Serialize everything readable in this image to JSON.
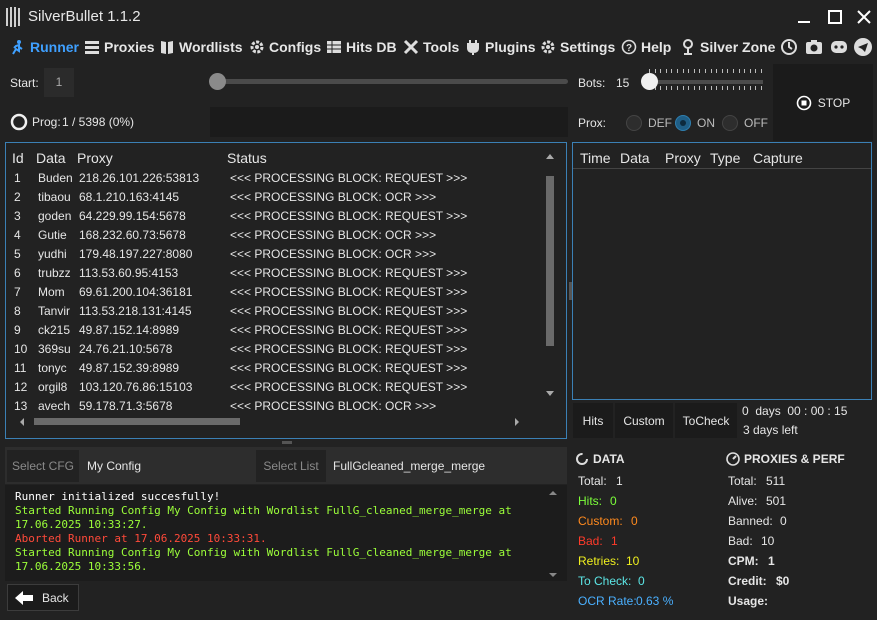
{
  "window": {
    "title": "SilverBullet 1.1.2"
  },
  "nav": [
    {
      "label": "Runner",
      "icon": "runner-icon"
    },
    {
      "label": "Proxies",
      "icon": "proxies-icon"
    },
    {
      "label": "Wordlists",
      "icon": "wordlists-icon"
    },
    {
      "label": "Configs",
      "icon": "configs-icon"
    },
    {
      "label": "Hits DB",
      "icon": "hitsdb-icon"
    },
    {
      "label": "Tools",
      "icon": "tools-icon"
    },
    {
      "label": "Plugins",
      "icon": "plugins-icon"
    },
    {
      "label": "Settings",
      "icon": "settings-icon"
    },
    {
      "label": "Help",
      "icon": "help-icon"
    },
    {
      "label": "Silver Zone",
      "icon": "pin-icon"
    }
  ],
  "controls": {
    "start_label": "Start:",
    "start_value": "1",
    "bots_label": "Bots:",
    "bots_value": "15",
    "stop_label": "STOP",
    "prog_label": "Prog:",
    "prog_value": "1 / 5398 (0%)",
    "prox_label": "Prox:",
    "prox_options": [
      "DEF",
      "ON",
      "OFF"
    ],
    "prox_selected": "ON"
  },
  "grid": {
    "columns": [
      "Id",
      "Data",
      "Proxy",
      "Status"
    ],
    "rows": [
      {
        "id": "1",
        "data": "Buden",
        "proxy": "218.26.101.226:53813",
        "status": "<<< PROCESSING BLOCK: REQUEST >>>"
      },
      {
        "id": "2",
        "data": "tibaou",
        "proxy": "68.1.210.163:4145",
        "status": "<<< PROCESSING BLOCK: OCR >>>"
      },
      {
        "id": "3",
        "data": "goden",
        "proxy": "64.229.99.154:5678",
        "status": "<<< PROCESSING BLOCK: REQUEST >>>"
      },
      {
        "id": "4",
        "data": "Gutie",
        "proxy": "168.232.60.73:5678",
        "status": "<<< PROCESSING BLOCK: OCR >>>"
      },
      {
        "id": "5",
        "data": "yudhi",
        "proxy": "179.48.197.227:8080",
        "status": "<<< PROCESSING BLOCK: OCR >>>"
      },
      {
        "id": "6",
        "data": "trubzz",
        "proxy": "113.53.60.95:4153",
        "status": "<<< PROCESSING BLOCK: REQUEST >>>"
      },
      {
        "id": "7",
        "data": "Mom",
        "proxy": "69.61.200.104:36181",
        "status": "<<< PROCESSING BLOCK: REQUEST >>>"
      },
      {
        "id": "8",
        "data": "Tanvir",
        "proxy": "113.53.218.131:4145",
        "status": "<<< PROCESSING BLOCK: REQUEST >>>"
      },
      {
        "id": "9",
        "data": "ck215",
        "proxy": "49.87.152.14:8989",
        "status": "<<< PROCESSING BLOCK: REQUEST >>>"
      },
      {
        "id": "10",
        "data": "369su",
        "proxy": "24.76.21.10:5678",
        "status": "<<< PROCESSING BLOCK: REQUEST >>>"
      },
      {
        "id": "11",
        "data": "tonyc",
        "proxy": "49.87.152.39:8989",
        "status": "<<< PROCESSING BLOCK: REQUEST >>>"
      },
      {
        "id": "12",
        "data": "orgil8",
        "proxy": "103.120.76.86:15103",
        "status": "<<< PROCESSING BLOCK: REQUEST >>>"
      },
      {
        "id": "13",
        "data": "avech",
        "proxy": "59.178.71.3:5678",
        "status": "<<< PROCESSING BLOCK: OCR >>>"
      }
    ]
  },
  "hits": {
    "columns": [
      "Time",
      "Data",
      "Proxy",
      "Type",
      "Capture"
    ],
    "tabs": [
      "Hits",
      "Custom",
      "ToCheck"
    ],
    "timer": "0  days  00 : 00 : 15",
    "days_left": "3 days left"
  },
  "cfg": {
    "select_cfg_label": "Select CFG",
    "cfg_value": "My Config",
    "select_list_label": "Select List",
    "list_value": "FullGcleaned_merge_merge"
  },
  "log": [
    {
      "text": "Runner initialized succesfully!",
      "color": "#ffffff"
    },
    {
      "text": "Started Running Config My Config with Wordlist FullG_cleaned_merge_merge at 17.06.2025 10:33:27.",
      "color": "#9cff3a"
    },
    {
      "text": "Aborted Runner at 17.06.2025 10:33:31.",
      "color": "#ff4a3a"
    },
    {
      "text": "Started Running Config My Config with Wordlist FullG_cleaned_merge_merge at 17.06.2025 10:33:56.",
      "color": "#9cff3a"
    }
  ],
  "back_label": "Back",
  "data_stats": {
    "header": "DATA",
    "items": [
      {
        "label": "Total:",
        "value": "1",
        "color": "#e6e6e6"
      },
      {
        "label": "Hits:",
        "value": "0",
        "color": "#7cff3a"
      },
      {
        "label": "Custom:",
        "value": "0",
        "color": "#ff8a1e"
      },
      {
        "label": "Bad:",
        "value": "1",
        "color": "#ff3a2a"
      },
      {
        "label": "Retries:",
        "value": "10",
        "color": "#f0f01e"
      },
      {
        "label": "To Check:",
        "value": "0",
        "color": "#5ce6e6"
      },
      {
        "label": "OCR Rate:",
        "value": "0.63 %",
        "color": "#4ab0ff"
      }
    ]
  },
  "proxy_stats": {
    "header": "PROXIES & PERF",
    "items": [
      {
        "label": "Total:",
        "value": "511"
      },
      {
        "label": "Alive:",
        "value": "501"
      },
      {
        "label": "Banned:",
        "value": "0"
      },
      {
        "label": "Bad:",
        "value": "10"
      },
      {
        "label": "CPM:",
        "value": "1"
      },
      {
        "label": "Credit:",
        "value": "$0"
      },
      {
        "label": "Usage:",
        "value": ""
      }
    ]
  }
}
